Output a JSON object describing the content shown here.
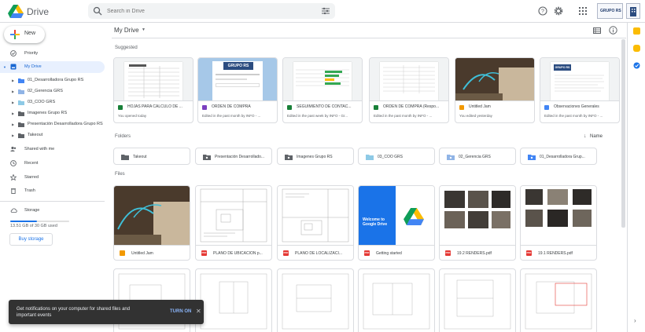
{
  "app": {
    "name": "Drive"
  },
  "search": {
    "placeholder": "Search in Drive"
  },
  "header": {
    "brand_tile_text": "GRUPO RS"
  },
  "new_button": {
    "label": "New"
  },
  "nav": {
    "priority": "Priority",
    "my_drive": "My Drive",
    "shared": "Shared with me",
    "recent": "Recent",
    "starred": "Starred",
    "trash": "Trash",
    "storage": "Storage"
  },
  "tree": [
    {
      "label": "01_Desarrolladora Grupo RS"
    },
    {
      "label": "02_Gerencia GRS"
    },
    {
      "label": "03_COO GRS"
    },
    {
      "label": "Imagenes Grupo RS"
    },
    {
      "label": "Presentación Desarrolladora Grupo RS"
    },
    {
      "label": "Takeout"
    }
  ],
  "storage": {
    "used_text": "13.51 GB of 30 GB used",
    "fraction": 0.45,
    "buy_label": "Buy storage"
  },
  "breadcrumb": {
    "title": "My Drive"
  },
  "sections": {
    "suggested": "Suggested",
    "folders": "Folders",
    "files": "Files",
    "sort": "Name"
  },
  "suggested": [
    {
      "name": "HOJAS PARA CALCULO DE ...",
      "sub": "You opened today",
      "icon_color": "#188038"
    },
    {
      "name": "ORDEN DE COMPRA",
      "sub": "Edited in the past month by INFO - ...",
      "icon_color": "#7b3fbf",
      "overlay": "GRUPO RS"
    },
    {
      "name": "SEGUIMIENTO DE CONTAC...",
      "sub": "Edited in the past week by INFO - Gr...",
      "icon_color": "#188038"
    },
    {
      "name": "ORDEN DE COMPRA (Respo...",
      "sub": "Edited in the past month by INFO - ...",
      "icon_color": "#188038"
    },
    {
      "name": "Untitled Jam",
      "sub": "You edited yesterday",
      "icon_color": "#f29900"
    },
    {
      "name": "Observaciones Generales",
      "sub": "Edited in the past month by INFO - ...",
      "icon_color": "#4285f4",
      "overlay": "GRUPO RS"
    }
  ],
  "folders": [
    {
      "name": "Takeout",
      "color": "#5f6368"
    },
    {
      "name": "Presentación Desarrollado...",
      "color": "#5f6368"
    },
    {
      "name": "Imagenes Grupo RS",
      "color": "#5f6368"
    },
    {
      "name": "03_COO GRS",
      "color": "#8ecae6"
    },
    {
      "name": "02_Gerencia GRS",
      "color": "#90b4e6"
    },
    {
      "name": "01_Desarrolladora Grup...",
      "color": "#4285f4"
    }
  ],
  "files": [
    {
      "name": "Untitled Jam",
      "icon": "",
      "icon_color": "#f29900"
    },
    {
      "name": "PLANO DE UBICACION p...",
      "icon": "PDF",
      "icon_color": "#e53935"
    },
    {
      "name": "PLANO DE LOCALIZACI...",
      "icon": "PDF",
      "icon_color": "#e53935"
    },
    {
      "name": "Getting started",
      "icon": "PDF",
      "icon_color": "#e53935",
      "promo_title": "Welcome to Google Drive"
    },
    {
      "name": "19.2 RENDERS.pdf",
      "icon": "PDF",
      "icon_color": "#e53935"
    },
    {
      "name": "19.1 RENDERS.pdf",
      "icon": "PDF",
      "icon_color": "#e53935"
    }
  ],
  "toast": {
    "message": "Get notifications on your computer for shared files and important events",
    "action": "TURN ON"
  },
  "colors": {
    "accent": "#1a73e8",
    "active_bg": "#e8f0fe"
  }
}
